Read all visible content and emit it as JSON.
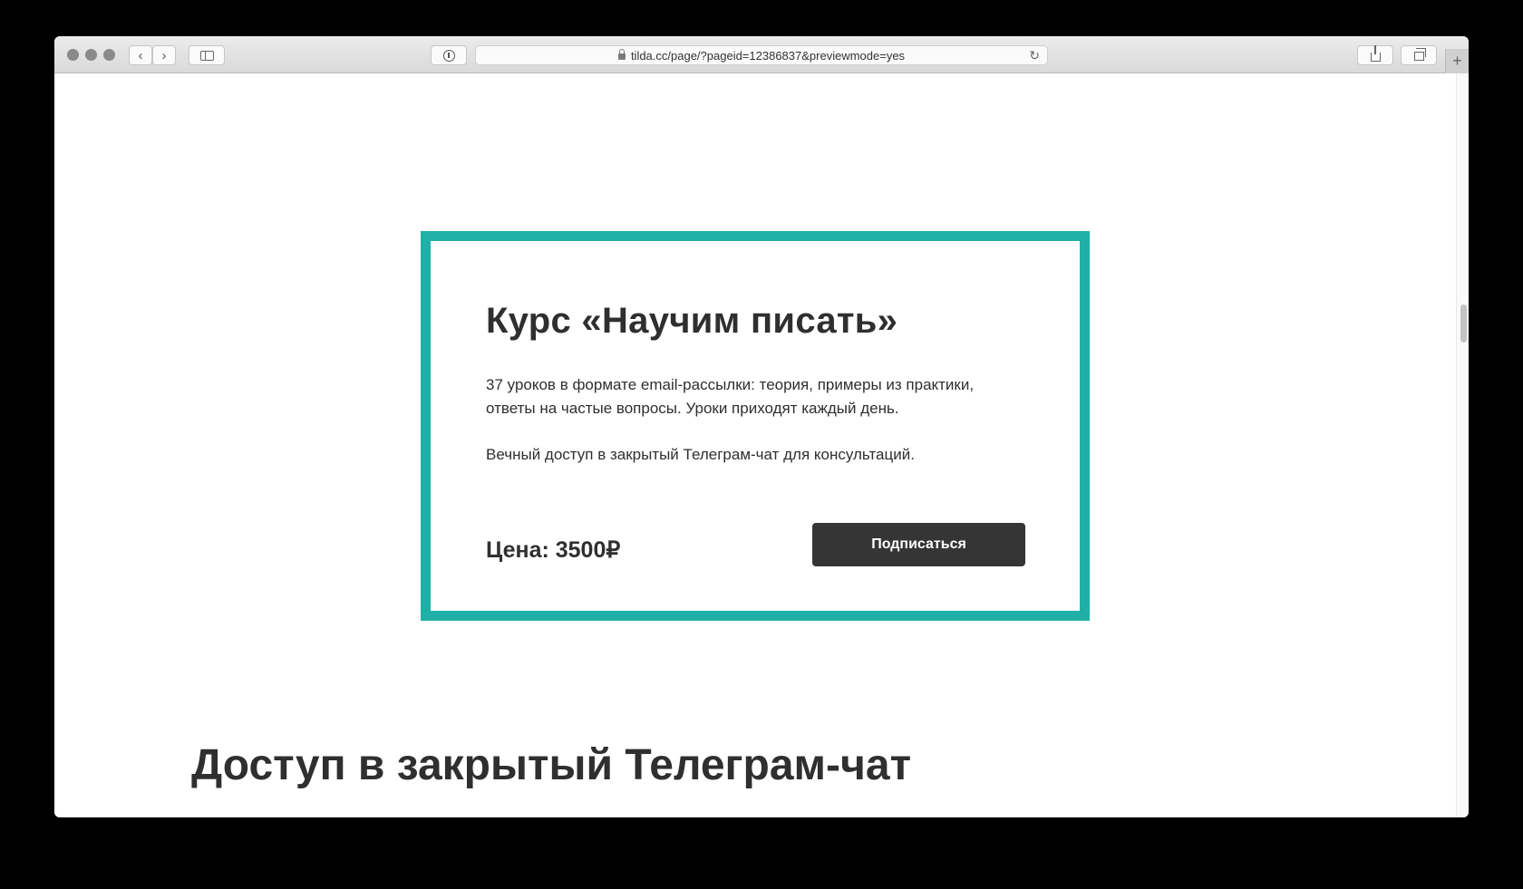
{
  "browser": {
    "url": "tilda.cc/page/?pageid=12386837&previewmode=yes",
    "icons": {
      "back": "chevron-left-icon",
      "forward": "chevron-right-icon",
      "sidebar": "sidebar-icon",
      "privacy": "privacy-report-icon",
      "reload": "reload-icon",
      "share": "share-icon",
      "tabs": "tabs-overview-icon",
      "new_tab": "plus-icon"
    }
  },
  "card": {
    "title": "Курс «Научим писать»",
    "description_line1": "37 уроков в формате email-рассылки: теория, примеры из практики, ответы на частые вопросы. Уроки приходят каждый день.",
    "description_line2": "Вечный доступ в закрытый Телеграм-чат для консультаций.",
    "price": "Цена: 3500₽",
    "button_label": "Подписаться",
    "border_color": "#20b0a7",
    "button_color": "#353535"
  },
  "section": {
    "heading": "Доступ в закрытый Телеграм-чат"
  }
}
